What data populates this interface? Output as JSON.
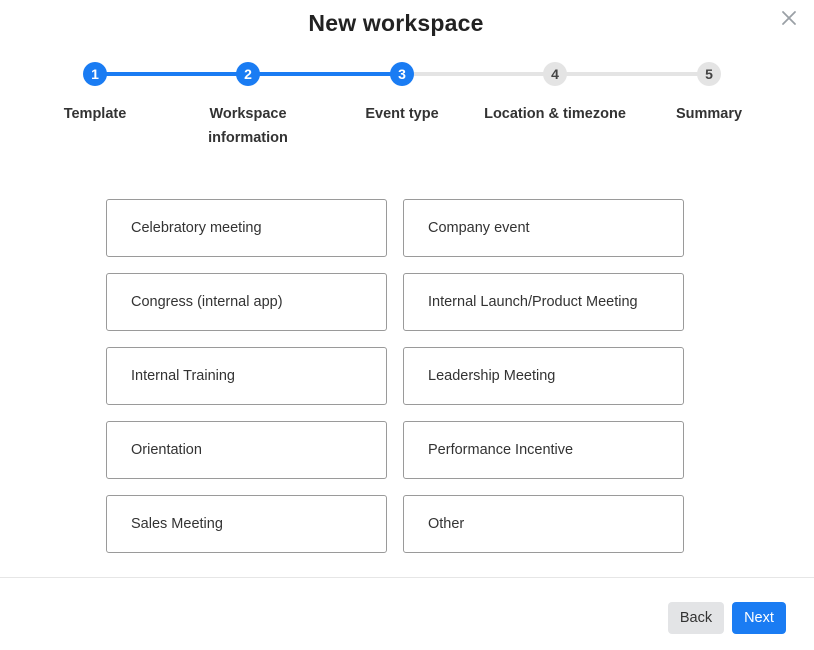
{
  "dialog": {
    "title": "New workspace",
    "close_icon": "close-icon"
  },
  "stepper": {
    "current_step": 3,
    "steps": [
      {
        "number": "1",
        "label": "Template",
        "state": "completed"
      },
      {
        "number": "2",
        "label": "Workspace information",
        "state": "completed"
      },
      {
        "number": "3",
        "label": "Event type",
        "state": "current"
      },
      {
        "number": "4",
        "label": "Location & timezone",
        "state": "upcoming"
      },
      {
        "number": "5",
        "label": "Summary",
        "state": "upcoming"
      }
    ]
  },
  "event_types": [
    "Celebratory meeting",
    "Company event",
    "Congress (internal app)",
    "Internal Launch/Product Meeting",
    "Internal Training",
    "Leadership Meeting",
    "Orientation",
    "Performance Incentive",
    "Sales Meeting",
    "Other"
  ],
  "footer": {
    "back_label": "Back",
    "next_label": "Next"
  },
  "colors": {
    "accent": "#1a7cf3",
    "inactive_step": "#e4e4e4",
    "option_border": "#9a9a9a",
    "back_button_bg": "#e3e4e6"
  }
}
